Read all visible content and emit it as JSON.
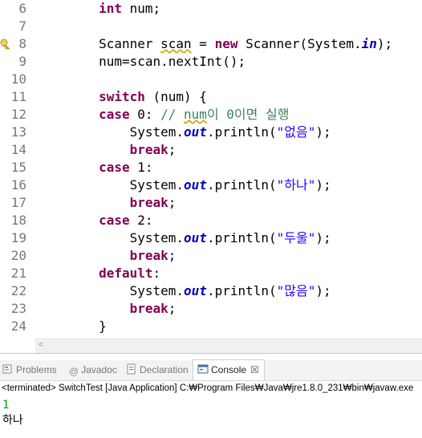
{
  "editor": {
    "lines": [
      {
        "num": "6",
        "tokens": [
          {
            "t": "        ",
            "c": ""
          },
          {
            "t": "int",
            "c": "kw"
          },
          {
            "t": " num;",
            "c": ""
          }
        ]
      },
      {
        "num": "7",
        "tokens": []
      },
      {
        "num": "8",
        "warning": true,
        "tokens": [
          {
            "t": "        Scanner ",
            "c": ""
          },
          {
            "t": "scan",
            "c": "warn"
          },
          {
            "t": " = ",
            "c": ""
          },
          {
            "t": "new",
            "c": "kw"
          },
          {
            "t": " Scanner(System.",
            "c": ""
          },
          {
            "t": "in",
            "c": "fld"
          },
          {
            "t": ");",
            "c": ""
          }
        ]
      },
      {
        "num": "9",
        "tokens": [
          {
            "t": "        num=scan.nextInt();",
            "c": ""
          }
        ]
      },
      {
        "num": "10",
        "tokens": []
      },
      {
        "num": "11",
        "tokens": [
          {
            "t": "        ",
            "c": ""
          },
          {
            "t": "switch",
            "c": "kw"
          },
          {
            "t": " (num) {",
            "c": ""
          }
        ]
      },
      {
        "num": "12",
        "tokens": [
          {
            "t": "        ",
            "c": ""
          },
          {
            "t": "case",
            "c": "kw"
          },
          {
            "t": " 0: ",
            "c": ""
          },
          {
            "t": "// ",
            "c": "cmt"
          },
          {
            "t": "num",
            "c": "cmt cmtwarn"
          },
          {
            "t": "이 0이면 실행",
            "c": "cmt"
          }
        ]
      },
      {
        "num": "13",
        "tokens": [
          {
            "t": "            System.",
            "c": ""
          },
          {
            "t": "out",
            "c": "fld"
          },
          {
            "t": ".println(",
            "c": ""
          },
          {
            "t": "\"없음\"",
            "c": "str"
          },
          {
            "t": ");",
            "c": ""
          }
        ]
      },
      {
        "num": "14",
        "tokens": [
          {
            "t": "            ",
            "c": ""
          },
          {
            "t": "break",
            "c": "kw"
          },
          {
            "t": ";",
            "c": ""
          }
        ]
      },
      {
        "num": "15",
        "tokens": [
          {
            "t": "        ",
            "c": ""
          },
          {
            "t": "case",
            "c": "kw"
          },
          {
            "t": " 1:",
            "c": ""
          }
        ]
      },
      {
        "num": "16",
        "tokens": [
          {
            "t": "            System.",
            "c": ""
          },
          {
            "t": "out",
            "c": "fld"
          },
          {
            "t": ".println(",
            "c": ""
          },
          {
            "t": "\"하나\"",
            "c": "str"
          },
          {
            "t": ");",
            "c": ""
          }
        ]
      },
      {
        "num": "17",
        "tokens": [
          {
            "t": "            ",
            "c": ""
          },
          {
            "t": "break",
            "c": "kw"
          },
          {
            "t": ";",
            "c": ""
          }
        ]
      },
      {
        "num": "18",
        "tokens": [
          {
            "t": "        ",
            "c": ""
          },
          {
            "t": "case",
            "c": "kw"
          },
          {
            "t": " 2:",
            "c": ""
          }
        ]
      },
      {
        "num": "19",
        "tokens": [
          {
            "t": "            System.",
            "c": ""
          },
          {
            "t": "out",
            "c": "fld"
          },
          {
            "t": ".println(",
            "c": ""
          },
          {
            "t": "\"두울\"",
            "c": "str"
          },
          {
            "t": ");",
            "c": ""
          }
        ]
      },
      {
        "num": "20",
        "tokens": [
          {
            "t": "            ",
            "c": ""
          },
          {
            "t": "break",
            "c": "kw"
          },
          {
            "t": ";",
            "c": ""
          }
        ]
      },
      {
        "num": "21",
        "tokens": [
          {
            "t": "        ",
            "c": ""
          },
          {
            "t": "default",
            "c": "kw"
          },
          {
            "t": ":",
            "c": ""
          }
        ]
      },
      {
        "num": "22",
        "tokens": [
          {
            "t": "            System.",
            "c": ""
          },
          {
            "t": "out",
            "c": "fld"
          },
          {
            "t": ".println(",
            "c": ""
          },
          {
            "t": "\"많음\"",
            "c": "str"
          },
          {
            "t": ");",
            "c": ""
          }
        ]
      },
      {
        "num": "23",
        "tokens": [
          {
            "t": "            ",
            "c": ""
          },
          {
            "t": "break",
            "c": "kw"
          },
          {
            "t": ";",
            "c": ""
          }
        ]
      },
      {
        "num": "24",
        "tokens": [
          {
            "t": "        }",
            "c": ""
          }
        ]
      }
    ],
    "hscroll_left_arrow": "<"
  },
  "views": {
    "tabs": [
      {
        "label": "Problems",
        "icon": "problems-icon"
      },
      {
        "label": "Javadoc",
        "icon": "javadoc-icon"
      },
      {
        "label": "Declaration",
        "icon": "declaration-icon"
      },
      {
        "label": "Console",
        "icon": "console-icon",
        "active": true
      }
    ],
    "close_glyph": "☒",
    "console": {
      "terminated_line": "<terminated> SwitchTest [Java Application] C:₩Program Files₩Java₩jre1.8.0_231₩bin₩javaw.exe",
      "input_echo": "1",
      "output": "하나"
    }
  },
  "colors": {
    "keyword": "#7f0055",
    "field": "#0000c0",
    "string": "#2a00ff",
    "comment": "#3f7f5f",
    "input_echo": "#00a000",
    "line_number": "#787878"
  }
}
